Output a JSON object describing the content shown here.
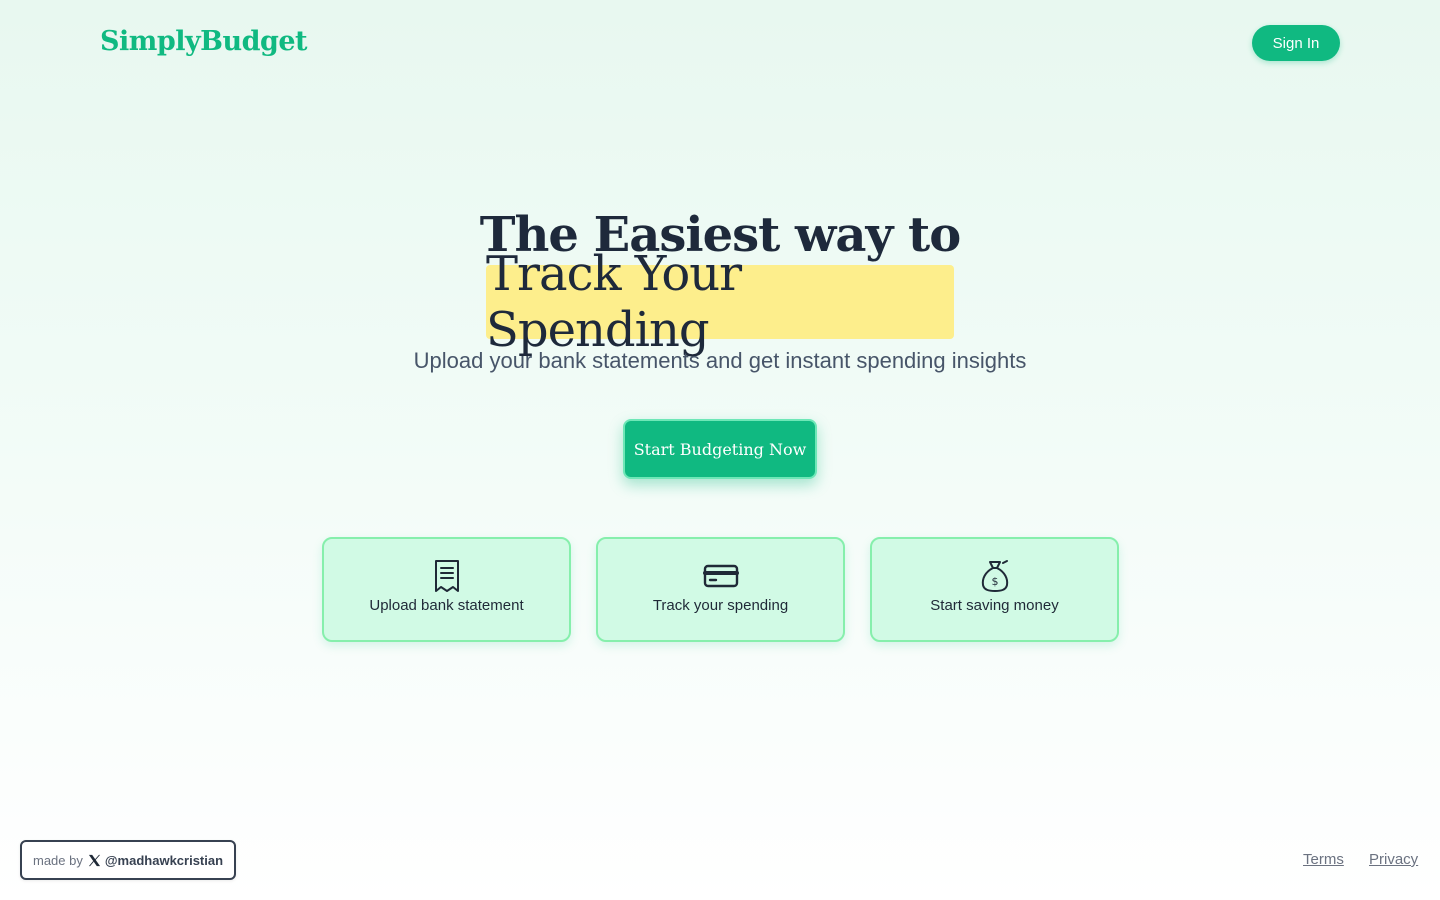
{
  "header": {
    "logo": "SimplyBudget",
    "signin_label": "Sign In"
  },
  "hero": {
    "line1": "The Easiest way to",
    "highlight": "Track Your Spending",
    "subtitle": "Upload your bank statements and get instant spending insights",
    "cta_label": "Start Budgeting Now"
  },
  "features": [
    {
      "icon": "document-icon",
      "label": "Upload bank statement"
    },
    {
      "icon": "credit-card-icon",
      "label": "Track your spending"
    },
    {
      "icon": "money-bag-icon",
      "label": "Start saving money"
    }
  ],
  "badge": {
    "prefix": "made by",
    "icon": "x-logo-icon",
    "handle": "@madhawkcristian"
  },
  "footer": {
    "terms": "Terms",
    "privacy": "Privacy"
  },
  "colors": {
    "brand": "#10b981",
    "highlight": "#fdee8c",
    "card_bg": "#d1fae5",
    "card_border": "#86efac"
  }
}
